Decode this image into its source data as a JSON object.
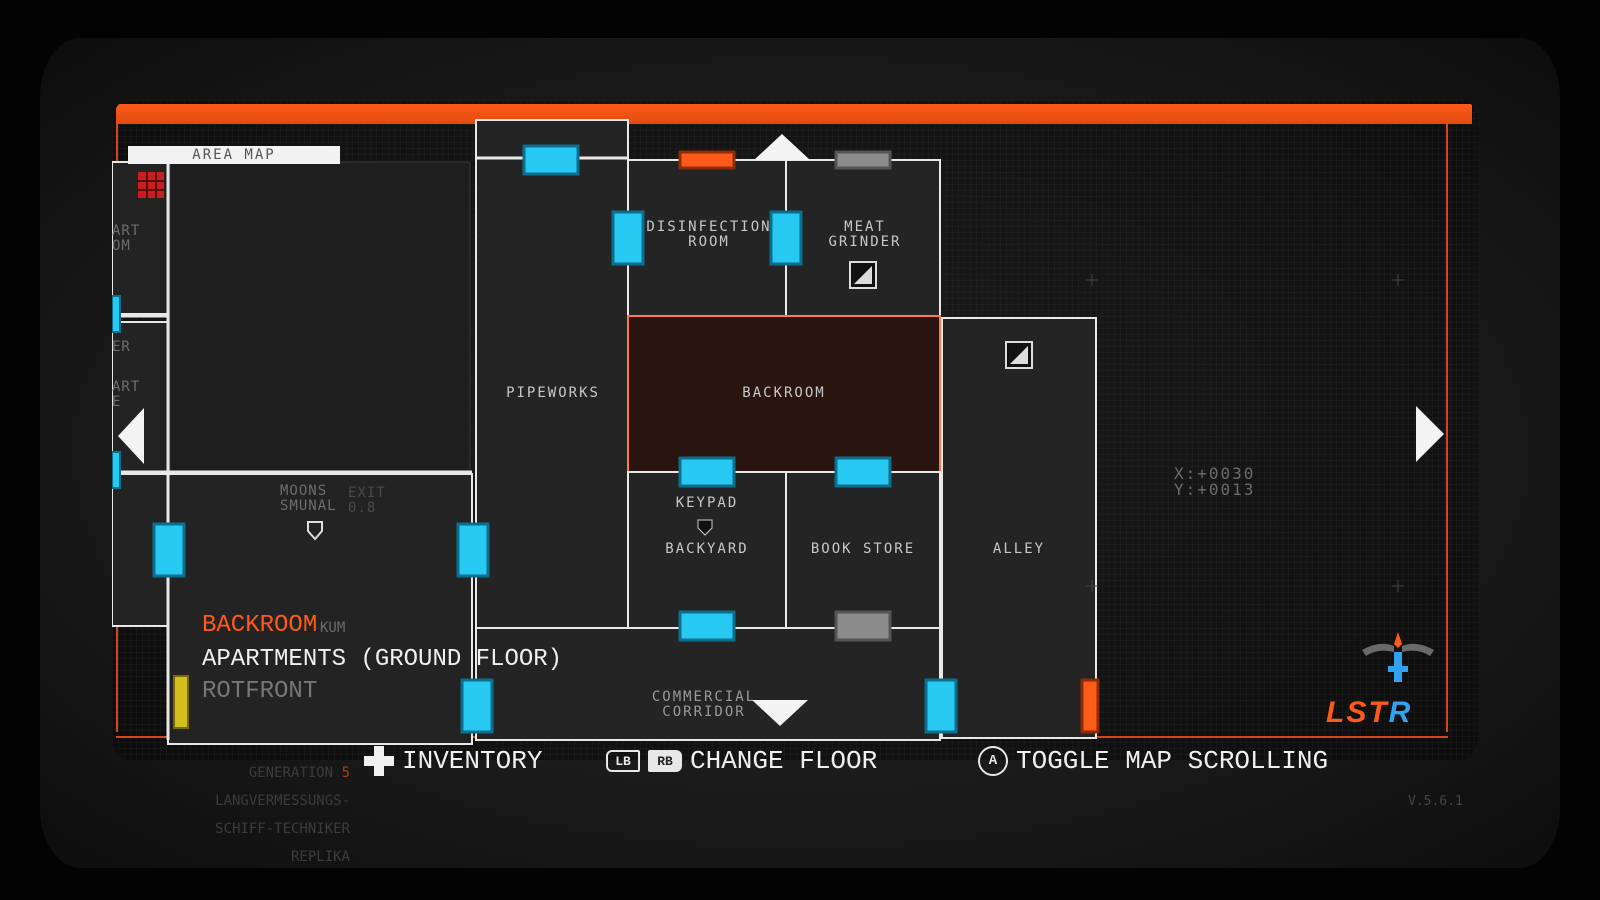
{
  "colors": {
    "accent": "#ff5a1a",
    "door_active": "#27c8f2",
    "door_locked": "#9a9a9a",
    "door_red": "#ff5a1a",
    "wall": "#e8e8e8",
    "current_room": "#2a1410"
  },
  "header": {
    "area_label": "AREA MAP"
  },
  "map": {
    "rooms": {
      "disinfection": "DISINFECTION\nROOM",
      "meat_grinder": "MEAT\nGRINDER",
      "pipeworks": "PIPEWORKS",
      "backroom": "BACKROOM",
      "keypad": "KEYPAD",
      "backyard": "BACKYARD",
      "book_store": "BOOK STORE",
      "alley": "ALLEY",
      "commercial_corridor": "COMMERCIAL\nCORRIDOR"
    },
    "partial_labels": {
      "left_top": "ART\nOM",
      "left_mid": "ER",
      "left_mid2": "ART\nE",
      "overlap_a": "MOONS\nSMUNAL",
      "overlap_b": "EXIT\n0.8"
    },
    "current_room_id": "backroom",
    "icons": {
      "save_points": [
        "stairs-icon",
        "stairs-icon"
      ],
      "player_marker": "player-marker-icon",
      "left_room_marker": "grid-icon"
    }
  },
  "coordinates": {
    "x": "X:+0030",
    "y": "Y:+0013"
  },
  "location": {
    "current": "BACKROOM",
    "current_suffix": "KUM",
    "floor": "APARTMENTS (GROUND FLOOR)",
    "district": "ROTFRONT"
  },
  "navigation": {
    "up": "floor-up-arrow",
    "down": "floor-down-arrow",
    "left": "scroll-left-arrow",
    "right": "scroll-right-arrow"
  },
  "logo": {
    "text_main": "LST",
    "text_tail": "R"
  },
  "hud": {
    "inventory_label": "INVENTORY",
    "change_floor_label": "CHANGE FLOOR",
    "lb": "LB",
    "rb": "RB",
    "a_button": "A",
    "toggle_label": "TOGGLE MAP SCROLLING"
  },
  "unit_info": {
    "generation_label": "GENERATION",
    "generation_value": "5",
    "line2": "LANGVERMESSUNGS-",
    "line3": "SCHIFF-TECHNIKER",
    "line4": "REPLIKA"
  },
  "version": "V.5.6.1"
}
